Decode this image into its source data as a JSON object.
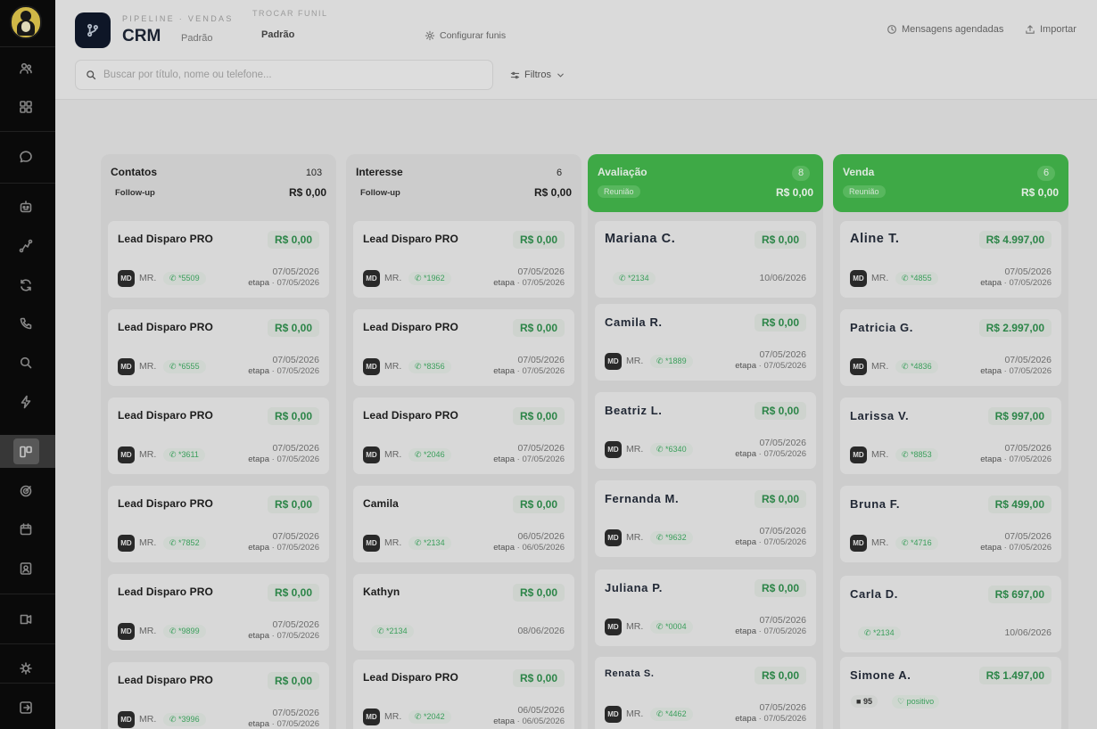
{
  "header": {
    "eyebrow": "Pipeline · Vendas",
    "title": "CRM",
    "subtitle": "Padrão",
    "switch_label": "Trocar funil",
    "switch_value": "Padrão",
    "config_label": "Configurar funis",
    "scheduled_label": "Mensagens agendadas",
    "import_label": "Importar",
    "search_placeholder": "Buscar por título, nome ou telefone...",
    "filters_label": "Filtros"
  },
  "columns": [
    {
      "title": "Contatos",
      "count": "103",
      "sub": "Follow-up",
      "total": "R$ 0,00",
      "cards": [
        {
          "title": "Lead Disparo PRO",
          "value": "R$ 0,00",
          "avatar": "MD",
          "owner": "MR.",
          "phone": "*5509",
          "date": "07/05/2026",
          "stage_label": "etapa",
          "stage_date": "07/05/2026"
        },
        {
          "title": "Lead Disparo PRO",
          "value": "R$ 0,00",
          "avatar": "MD",
          "owner": "MR.",
          "phone": "*6555",
          "date": "07/05/2026",
          "stage_label": "etapa",
          "stage_date": "07/05/2026"
        },
        {
          "title": "Lead Disparo PRO",
          "value": "R$ 0,00",
          "avatar": "MD",
          "owner": "MR.",
          "phone": "*3611",
          "date": "07/05/2026",
          "stage_label": "etapa",
          "stage_date": "07/05/2026"
        },
        {
          "title": "Lead Disparo PRO",
          "value": "R$ 0,00",
          "avatar": "MD",
          "owner": "MR.",
          "phone": "*7852",
          "date": "07/05/2026",
          "stage_label": "etapa",
          "stage_date": "07/05/2026"
        },
        {
          "title": "Lead Disparo PRO",
          "value": "R$ 0,00",
          "avatar": "MD",
          "owner": "MR.",
          "phone": "*9899",
          "date": "07/05/2026",
          "stage_label": "etapa",
          "stage_date": "07/05/2026"
        },
        {
          "title": "Lead Disparo PRO",
          "value": "R$ 0,00",
          "avatar": "MD",
          "owner": "MR.",
          "phone": "*3996",
          "date": "07/05/2026",
          "stage_label": "etapa",
          "stage_date": "07/05/2026"
        }
      ]
    },
    {
      "title": "Interesse",
      "count": "6",
      "sub": "Follow-up",
      "total": "R$ 0,00",
      "cards": [
        {
          "title": "Lead Disparo PRO",
          "value": "R$ 0,00",
          "avatar": "MD",
          "owner": "MR.",
          "phone": "*1962",
          "date": "07/05/2026",
          "stage_label": "etapa",
          "stage_date": "07/05/2026"
        },
        {
          "title": "Lead Disparo PRO",
          "value": "R$ 0,00",
          "avatar": "MD",
          "owner": "MR.",
          "phone": "*8356",
          "date": "07/05/2026",
          "stage_label": "etapa",
          "stage_date": "07/05/2026"
        },
        {
          "title": "Lead Disparo PRO",
          "value": "R$ 0,00",
          "avatar": "MD",
          "owner": "MR.",
          "phone": "*2046",
          "date": "07/05/2026",
          "stage_label": "etapa",
          "stage_date": "07/05/2026"
        },
        {
          "title": "Camila",
          "value": "R$ 0,00",
          "avatar": "MD",
          "owner": "MR.",
          "phone": "*2134",
          "date": "06/05/2026",
          "stage_label": "etapa",
          "stage_date": "06/05/2026"
        },
        {
          "title": "Kathyn",
          "value": "R$ 0,00",
          "phone": "*2134",
          "date": "08/06/2026"
        },
        {
          "title": "Lead Disparo PRO",
          "value": "R$ 0,00",
          "avatar": "MD",
          "owner": "MR.",
          "phone": "*2042",
          "date": "06/05/2026",
          "stage_label": "etapa",
          "stage_date": "06/05/2026"
        }
      ]
    },
    {
      "title": "Avaliação",
      "count": "8",
      "sub": "Reunião",
      "total": "R$ 0,00",
      "highlight": true,
      "cards": [
        {
          "title": "Mariana C.",
          "style": "big",
          "value": "R$ 0,00",
          "phone": "*2134",
          "date": "10/06/2026"
        },
        {
          "title": "Camila R.",
          "style": "mid",
          "value": "R$ 0,00",
          "avatar": "MD",
          "owner": "MR.",
          "phone": "*1889",
          "date": "07/05/2026",
          "stage_label": "etapa",
          "stage_date": "07/05/2026"
        },
        {
          "title": "Beatriz L.",
          "style": "mid",
          "value": "R$ 0,00",
          "avatar": "MD",
          "owner": "MR.",
          "phone": "*6340",
          "date": "07/05/2026",
          "stage_label": "etapa",
          "stage_date": "07/05/2026"
        },
        {
          "title": "Fernanda M.",
          "style": "mid",
          "value": "R$ 0,00",
          "avatar": "MD",
          "owner": "MR.",
          "phone": "*9632",
          "date": "07/05/2026",
          "stage_label": "etapa",
          "stage_date": "07/05/2026"
        },
        {
          "title": "Juliana P.",
          "style": "mid",
          "value": "R$ 0,00",
          "avatar": "MD",
          "owner": "MR.",
          "phone": "*0004",
          "date": "07/05/2026",
          "stage_label": "etapa",
          "stage_date": "07/05/2026"
        },
        {
          "title": "Renata S.",
          "style": "small",
          "value": "R$ 0,00",
          "avatar": "MD",
          "owner": "MR.",
          "phone": "*4462",
          "date": "07/05/2026",
          "stage_label": "etapa",
          "stage_date": "07/05/2026"
        }
      ]
    },
    {
      "title": "Venda",
      "count": "6",
      "sub": "Reunião",
      "total": "R$ 0,00",
      "highlight": true,
      "cards": [
        {
          "title": "Aline T.",
          "style": "big",
          "value": "R$ 4.997,00",
          "avatar": "MD",
          "owner": "MR.",
          "phone": "*4855",
          "date": "07/05/2026",
          "stage_label": "etapa",
          "stage_date": "07/05/2026"
        },
        {
          "title": "Patricia G.",
          "style": "mid",
          "value": "R$ 2.997,00",
          "avatar": "MD",
          "owner": "MR.",
          "phone": "*4836",
          "date": "07/05/2026",
          "stage_label": "etapa",
          "stage_date": "07/05/2026"
        },
        {
          "title": "Larissa V.",
          "style": "mid",
          "value": "R$ 997,00",
          "avatar": "MD",
          "owner": "MR.",
          "phone": "*8853",
          "date": "07/05/2026",
          "stage_label": "etapa",
          "stage_date": "07/05/2026"
        },
        {
          "title": "Bruna F.",
          "style": "mid",
          "value": "R$ 499,00",
          "avatar": "MD",
          "owner": "MR.",
          "phone": "*4716",
          "date": "07/05/2026",
          "stage_label": "etapa",
          "stage_date": "07/05/2026"
        },
        {
          "title": "Carla D.",
          "style": "mid",
          "value": "R$ 697,00",
          "phone": "*2134",
          "date": "10/06/2026"
        },
        {
          "title": "Simone A.",
          "style": "mid",
          "value": "R$ 1.497,00",
          "score": "95",
          "sentiment": "positivo"
        }
      ]
    }
  ],
  "colors": {
    "accent_green": "#41b049",
    "sidebar_bg": "#0b0b0b",
    "value_green": "#2e8b4b"
  }
}
